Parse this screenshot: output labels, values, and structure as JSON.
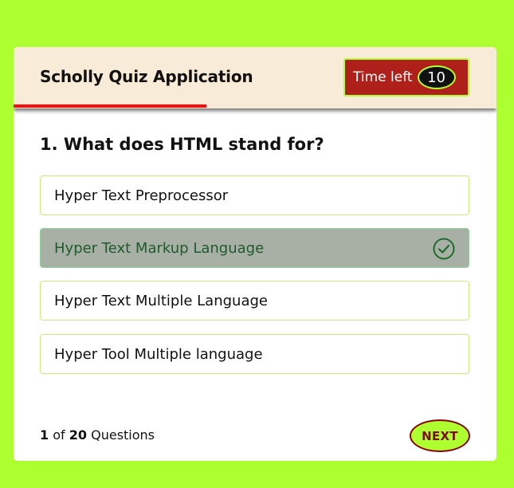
{
  "header": {
    "title": "Scholly Quiz Application",
    "timer_label": "Time left",
    "timer_value": "10",
    "time_remaining_fraction": 0.4
  },
  "question": {
    "text": "1. What does HTML stand for?"
  },
  "options": [
    {
      "label": "Hyper Text Preprocessor",
      "state": "default"
    },
    {
      "label": "Hyper Text Markup Language",
      "state": "correct"
    },
    {
      "label": "Hyper Text Multiple Language",
      "state": "default"
    },
    {
      "label": "Hyper Tool Multiple language",
      "state": "default"
    }
  ],
  "footer": {
    "current": "1",
    "of_label": "of",
    "total": "20",
    "questions_label": "Questions",
    "next_label": "NEXT"
  },
  "colors": {
    "page_background": "#adff2f",
    "header_background": "#f8ebd7",
    "timer_background": "#b0201b",
    "time_line": "#ff0a0a",
    "correct_background": "#a8b0a6",
    "correct_text": "#1e5a2c",
    "next_border": "#8b0000"
  },
  "icons": {
    "correct_mark": "check-circle-icon"
  }
}
